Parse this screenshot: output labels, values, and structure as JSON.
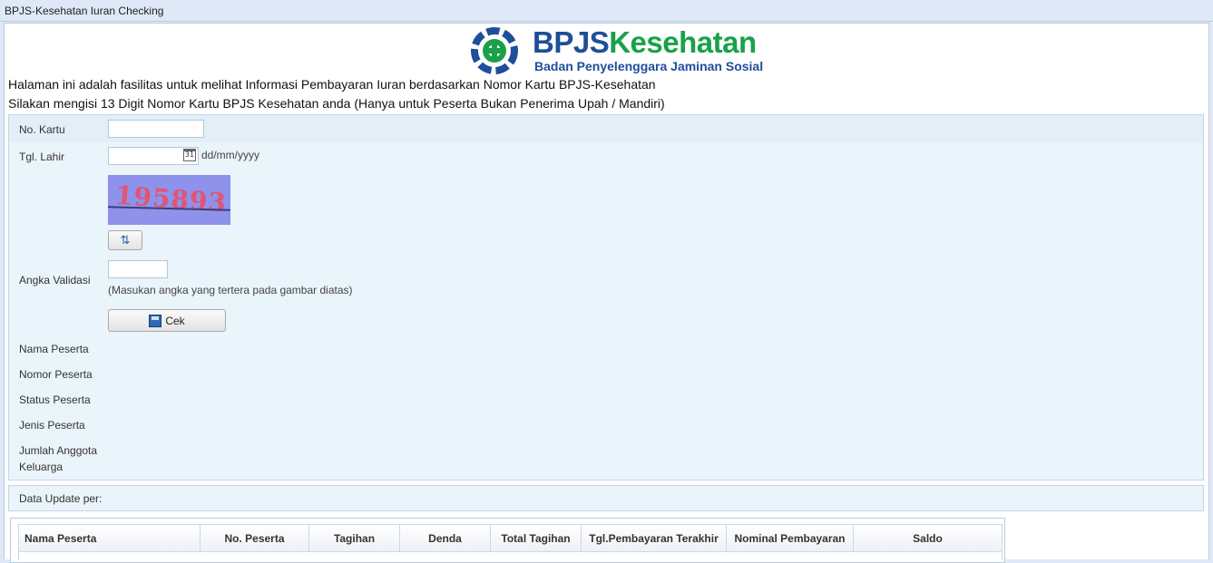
{
  "window": {
    "title": "BPJS-Kesehatan Iuran Checking"
  },
  "logo": {
    "brand_part1": "BPJS",
    "brand_part2": "Kesehatan",
    "tagline": "Badan Penyelenggara Jaminan Sosial",
    "colors": {
      "primary": "#1f4e9a",
      "secondary": "#19a14a"
    }
  },
  "intro": {
    "line1": "Halaman ini adalah fasilitas untuk melihat Informasi Pembayaran Iuran berdasarkan Nomor Kartu BPJS-Kesehatan",
    "line2": "Silakan mengisi 13 Digit Nomor Kartu BPJS Kesehatan anda (Hanya untuk Peserta Bukan Penerima Upah / Mandiri)"
  },
  "form": {
    "no_kartu": {
      "label": "No. Kartu",
      "value": ""
    },
    "tgl_lahir": {
      "label": "Tgl. Lahir",
      "value": "",
      "format_hint": "dd/mm/yyyy",
      "calendar_icon_text": "31"
    },
    "captcha": {
      "text": "195893"
    },
    "refresh_icon": "refresh-icon",
    "angka_validasi": {
      "label": "Angka Validasi",
      "value": "",
      "hint": "(Masukan angka yang tertera pada gambar diatas)"
    },
    "cek_button": {
      "label": "Cek"
    }
  },
  "result_fields": {
    "nama_peserta": "Nama Peserta",
    "nomor_peserta": "Nomor Peserta",
    "status_peserta": "Status Peserta",
    "jenis_peserta": "Jenis Peserta",
    "jumlah_anggota_line1": "Jumlah Anggota",
    "jumlah_anggota_line2": "Keluarga"
  },
  "status_bar": {
    "data_update": "Data Update per:"
  },
  "table": {
    "columns": [
      "Nama Peserta",
      "No. Peserta",
      "Tagihan",
      "Denda",
      "Total Tagihan",
      "Tgl.Pembayaran Terakhir",
      "Nominal Pembayaran",
      "Saldo"
    ]
  }
}
